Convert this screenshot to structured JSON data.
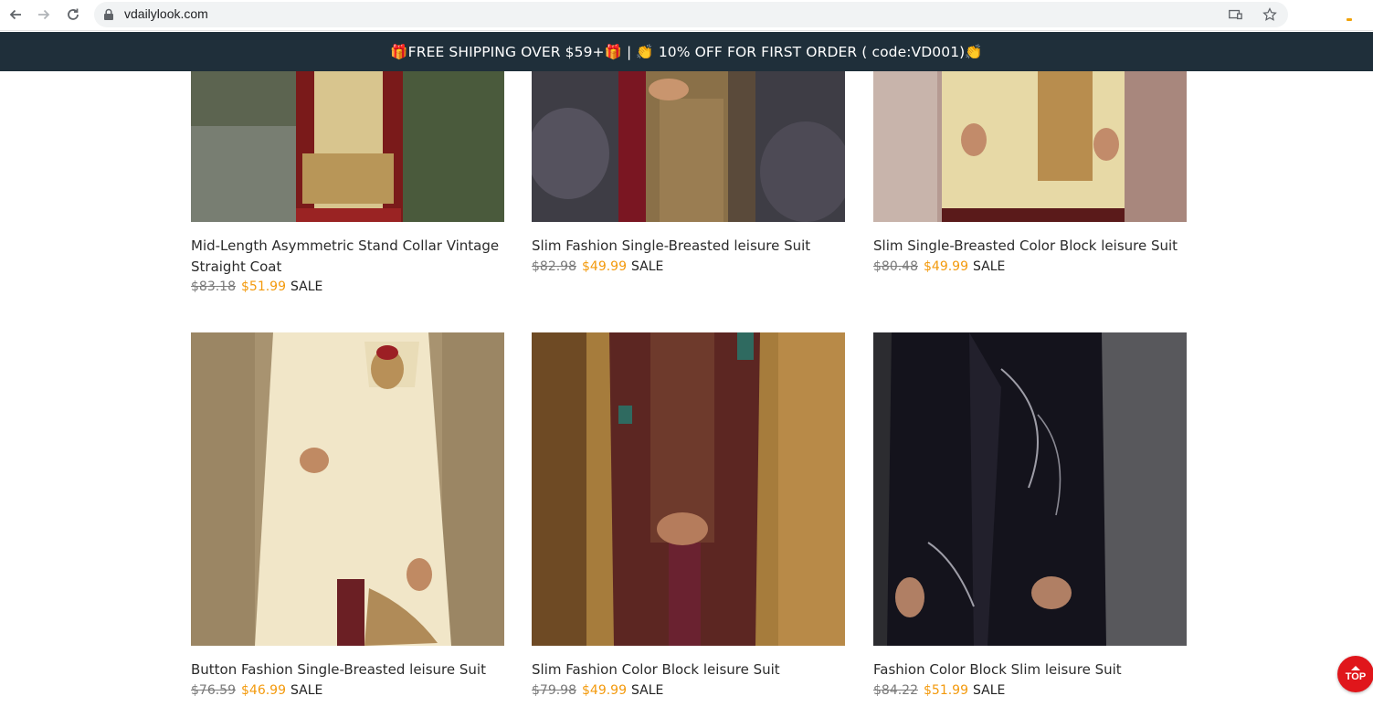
{
  "browser": {
    "url": "vdailylook.com"
  },
  "promo": {
    "text": "🎁FREE SHIPPING OVER $59+🎁 | 👏 10% OFF FOR FIRST ORDER ( code:VD001)👏"
  },
  "products": [
    {
      "title": "Mid-Length Asymmetric Stand Collar Vintage Straight Coat",
      "old_price": "$83.18",
      "price": "$51.99",
      "badge": "SALE"
    },
    {
      "title": "Slim Fashion Single-Breasted leisure Suit",
      "old_price": "$82.98",
      "price": "$49.99",
      "badge": "SALE"
    },
    {
      "title": "Slim Single-Breasted Color Block leisure Suit",
      "old_price": "$80.48",
      "price": "$49.99",
      "badge": "SALE"
    },
    {
      "title": "Button Fashion Single-Breasted leisure Suit",
      "old_price": "$76.59",
      "price": "$46.99",
      "badge": "SALE"
    },
    {
      "title": "Slim Fashion Color Block leisure Suit",
      "old_price": "$79.98",
      "price": "$49.99",
      "badge": "SALE"
    },
    {
      "title": "Fashion Color Block Slim leisure Suit",
      "old_price": "$84.22",
      "price": "$51.99",
      "badge": "SALE"
    }
  ],
  "top_button": {
    "label": "TOP"
  },
  "colors": {
    "banner": "#1f2f3a",
    "sale_price": "#f39a0d",
    "top_button": "#e0161b"
  }
}
